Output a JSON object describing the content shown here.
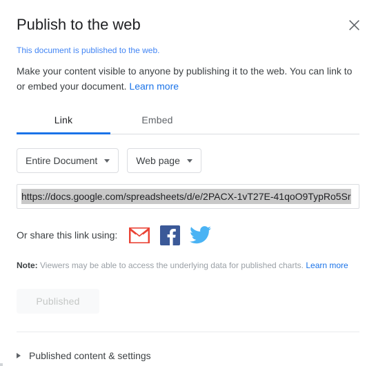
{
  "dialog": {
    "title": "Publish to the web",
    "close_icon": "close-icon"
  },
  "status": {
    "text": "This document is published to the web."
  },
  "description": {
    "text": "Make your content visible to anyone by publishing it to the web. You can link to or embed your document.",
    "learn_more": "Learn more"
  },
  "tabs": [
    {
      "label": "Link",
      "active": true
    },
    {
      "label": "Embed",
      "active": false
    }
  ],
  "selects": [
    {
      "value": "Entire Document",
      "icon": "chevron-down-icon"
    },
    {
      "value": "Web page",
      "icon": "chevron-down-icon"
    }
  ],
  "url_field": {
    "value": "https://docs.google.com/spreadsheets/d/e/2PACX-1vT27E-41qoO9TypRo5Sr",
    "selected": true
  },
  "share": {
    "label": "Or share this link using:",
    "icons": [
      {
        "name": "gmail-icon",
        "title": "Gmail"
      },
      {
        "name": "facebook-icon",
        "title": "Facebook"
      },
      {
        "name": "twitter-icon",
        "title": "Twitter"
      }
    ]
  },
  "note": {
    "prefix": "Note:",
    "text": "Viewers may be able to access the underlying data for published charts.",
    "learn_more": "Learn more"
  },
  "publish_button": {
    "label": "Published",
    "disabled": true
  },
  "footer": {
    "disclosure_label": "Published content & settings",
    "disclosure_icon": "triangle-right-icon"
  },
  "colors": {
    "accent": "#1a73e8",
    "status_blue": "#4285f4",
    "text_primary": "#202124",
    "text_secondary": "#3c4043",
    "text_muted": "#9aa0a6",
    "border": "#dadce0",
    "selection": "#c8c8c8",
    "gmail_red": "#ea4335",
    "facebook_blue": "#3b5998",
    "twitter_blue": "#4ab3f4"
  }
}
